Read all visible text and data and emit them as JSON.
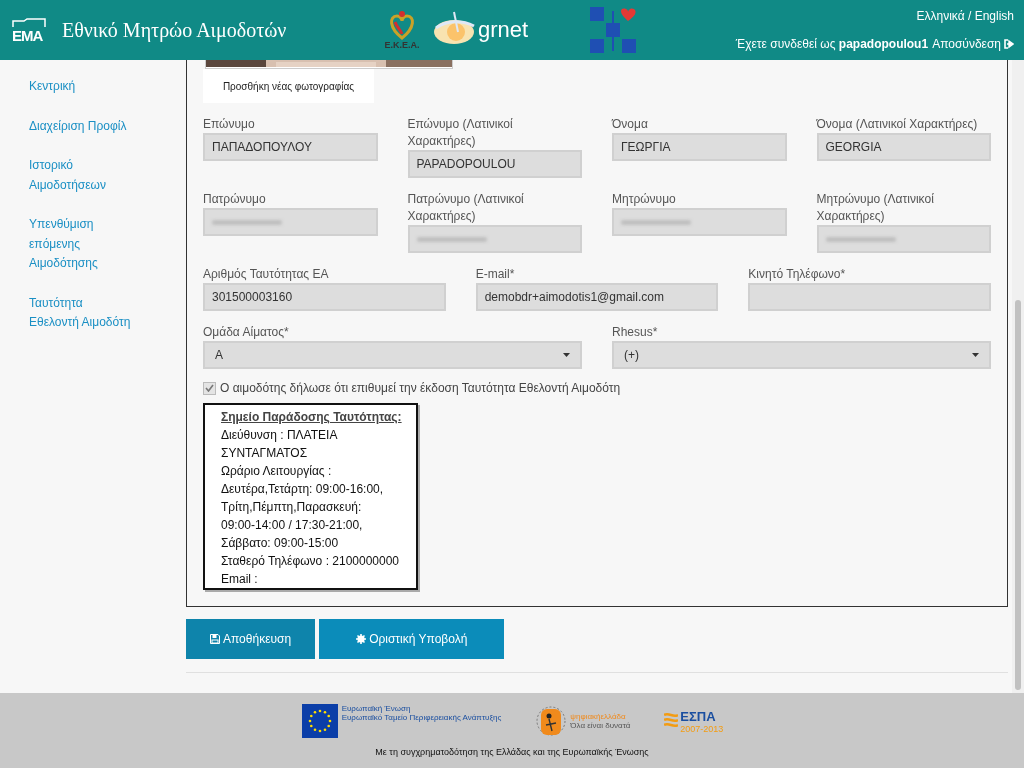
{
  "header": {
    "logo_text": "EMA",
    "title": "Εθνικό Μητρώο Αιμοδοτών",
    "partner_logos": [
      {
        "kind": "ekea",
        "text": "Ε.Κ.Ε.Α."
      },
      {
        "kind": "grnet",
        "text": "grnet"
      },
      {
        "kind": "health"
      }
    ],
    "language_switch": "Ελληνικά / English",
    "login_prefix": "Έχετε συνδεθεί ως",
    "username": "papadopoulou1",
    "logout": "Αποσύνδεση"
  },
  "sidebar": {
    "items": [
      {
        "label": "Κεντρική"
      },
      {
        "label": "Διαχείριση Προφίλ"
      },
      {
        "label": "Ιστορικό Αιμοδοτήσεων"
      },
      {
        "label": "Υπενθύμιση επόμενης Αιμοδότησης"
      },
      {
        "label": "Ταυτότητα Εθελοντή Αιμοδότη"
      }
    ]
  },
  "photo": {
    "kind": "picture",
    "caption": "Προσθήκη νέας φωτογραφίας"
  },
  "form": {
    "rows": [
      {
        "fields": [
          {
            "kind": "text",
            "label": "Επώνυμο",
            "value": "ΠΑΠΑΔΟΠΟΥΛΟΥ"
          },
          {
            "kind": "text",
            "label": "Επώνυμο (Λατινικοί Χαρακτήρες)",
            "value": "PAPADOPOULOU"
          },
          {
            "kind": "text",
            "label": "Όνομα",
            "value": "ΓΕΩΡΓΙΑ"
          },
          {
            "kind": "text",
            "label": "Όνομα (Λατινικοί Χαρακτήρες)",
            "value": "GEORGIA"
          }
        ]
      },
      {
        "fields": [
          {
            "kind": "text",
            "label": "Πατρώνυμο",
            "redacted": true
          },
          {
            "kind": "text",
            "label": "Πατρώνυμο (Λατινικοί Χαρακτήρες)",
            "redacted": true
          },
          {
            "kind": "text",
            "label": "Μητρώνυμο",
            "redacted": true
          },
          {
            "kind": "text",
            "label": "Μητρώνυμο (Λατινικοί Χαρακτήρες)",
            "redacted": true
          }
        ]
      },
      {
        "fields": [
          {
            "kind": "text",
            "label": "Αριθμός Ταυτότητας ΕΑ",
            "value": "301500003160"
          },
          {
            "kind": "text",
            "label": "E-mail*",
            "value": "demobdr+aimodotis1@gmail.com"
          },
          {
            "kind": "text",
            "label": "Κινητό Τηλέφωνο*"
          }
        ]
      },
      {
        "fields": [
          {
            "kind": "select",
            "label": "Ομάδα Αίματος*",
            "value": "A"
          },
          {
            "kind": "select",
            "label": "Rhesus*",
            "value": "(+)"
          }
        ]
      }
    ],
    "consent": {
      "label": "Ο αιμοδότης δήλωσε ότι επιθυμεί την έκδοση Ταυτότητα Εθελοντή Αιμοδότη",
      "checked": true,
      "disabled": true
    },
    "delivery_point": {
      "title": "Σημείο Παράδοσης Ταυτότητας:",
      "lines": [
        "Διεύθυνση : ΠΛΑΤΕΙΑ ΣΥΝΤΑΓΜΑΤΟΣ",
        "Ωράριο Λειτουργίας :",
        "Δευτέρα,Τετάρτη: 09:00-16:00,",
        "Τρίτη,Πέμπτη,Παρασκευή:",
        "09:00-14:00 / 17:30-21:00,",
        "Σάββατο: 09:00-15:00",
        "Σταθερό Τηλέφωνο : 2100000000",
        "Email :"
      ]
    }
  },
  "buttons": [
    {
      "label": "Αποθήκευση"
    },
    {
      "label": "Οριστική Υποβολή"
    }
  ],
  "footer": {
    "logos": [
      {
        "kind": "eu",
        "lines": [
          "Ευρωπαϊκή Ένωση",
          "Ευρωπαϊκό Ταμείο Περιφερειακής Ανάπτυξης"
        ]
      },
      {
        "kind": "digital",
        "lines": [
          "ψηφιακήελλάδα",
          "Όλα είναι δυνατά"
        ]
      },
      {
        "kind": "espa",
        "lines": [
          "ΕΣΠΑ",
          "2007-2013"
        ]
      }
    ],
    "text": "Με τη συγχρηματοδότηση της Ελλάδας και της Ευρωπαϊκής Ένωσης"
  }
}
